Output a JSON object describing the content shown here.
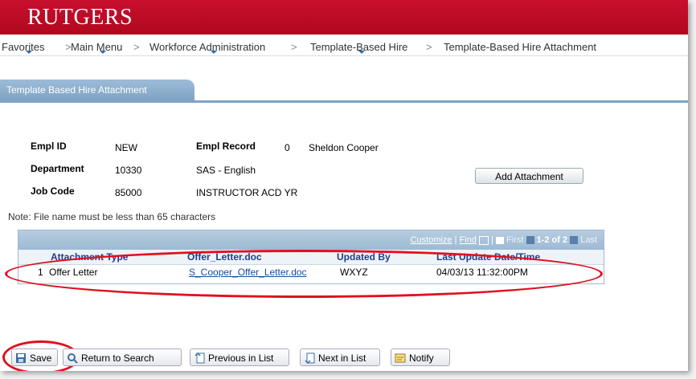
{
  "brand": "RUTGERS",
  "nav": {
    "favorites": "Favorites",
    "main_menu": "Main Menu",
    "sep": ">",
    "workforce": "Workforce Administration",
    "template_hire": "Template-Based Hire",
    "attachment": "Template-Based Hire Attachment"
  },
  "tab": {
    "label": "Template Based Hire Attachment"
  },
  "form": {
    "empl_id_label": "Empl ID",
    "empl_id": "NEW",
    "empl_record_label": "Empl Record",
    "empl_record": "0",
    "name": "Sheldon Cooper",
    "department_label": "Department",
    "department_code": "10330",
    "department_name": "SAS - English",
    "job_code_label": "Job Code",
    "job_code": "85000",
    "job_name": "INSTRUCTOR ACD YR",
    "add_attachment": "Add Attachment",
    "note": "Note: File name must be less than 65 characters"
  },
  "grid": {
    "customize": "Customize",
    "sep": "|",
    "find": "Find",
    "first": "First",
    "range": "1-2 of 2",
    "last": "Last",
    "columns": [
      "Attachment Type",
      "Offer_Letter.doc",
      "Updated By",
      "Last Update Date/Time"
    ],
    "rows": [
      {
        "num": "1",
        "type": "Offer Letter",
        "file": "S_Cooper_Offer_Letter.doc",
        "updated_by": "WXYZ",
        "updated": "04/03/13 11:32:00PM"
      }
    ]
  },
  "buttons": {
    "save": "Save",
    "return": "Return to Search",
    "previous": "Previous in List",
    "next": "Next in List",
    "notify": "Notify"
  },
  "colors": {
    "brand_red": "#c8102e",
    "tab_blue": "#7fa3c3",
    "highlight": "#e01020"
  }
}
